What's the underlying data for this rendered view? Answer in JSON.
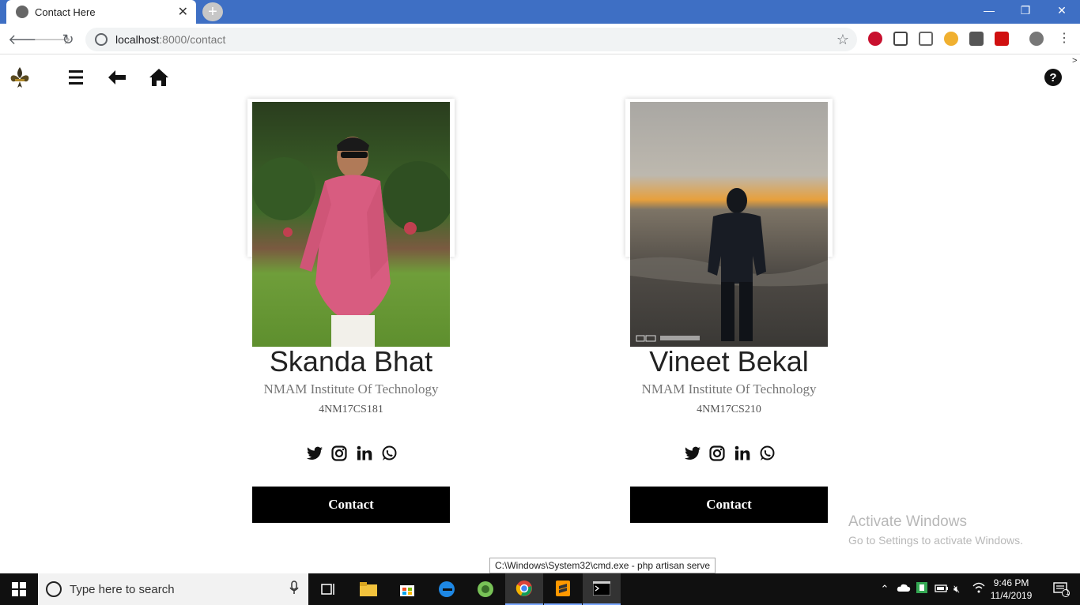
{
  "browser": {
    "tab_title": "Contact Here",
    "url_host": "localhost",
    "url_rest": ":8000/contact",
    "new_tab": "+",
    "back_arrow": "🡐",
    "forward_arrow": "🡒",
    "reload": "↻",
    "star": "☆",
    "corner_mark": ">"
  },
  "page": {
    "icons": [
      "fleur-de-lis-logo",
      "hamburger-menu-icon",
      "back-arrow-icon",
      "home-icon",
      "help-icon"
    ]
  },
  "contacts": [
    {
      "name": "Skanda Bhat",
      "institute": "NMAM Institute Of Technology",
      "usn": "4NM17CS181",
      "button": "Contact",
      "photo_colors": {
        "top": "#2f4a22",
        "mid": "#5c8a3a",
        "shirt": "#d85c80",
        "grass": "#6f9e3a"
      }
    },
    {
      "name": "Vineet Bekal",
      "institute": "NMAM Institute Of Technology",
      "usn": "4NM17CS210",
      "button": "Contact",
      "photo_colors": {
        "sky": "#b9b6b0",
        "horizon": "#e7a03c",
        "sea": "#4e4a45",
        "figure": "#14171c"
      }
    }
  ],
  "overlay": {
    "activate_title": "Activate Windows",
    "activate_sub": "Go to Settings to activate Windows.",
    "tooltip": "C:\\Windows\\System32\\cmd.exe - php  artisan serve"
  },
  "taskbar": {
    "search_placeholder": "Type here to search",
    "time": "9:46 PM",
    "date": "11/4/2019",
    "notification_count": "1"
  },
  "colors": {
    "titlebar": "#3e6fc4",
    "button_bg": "#000000",
    "taskbar": "#101010"
  }
}
